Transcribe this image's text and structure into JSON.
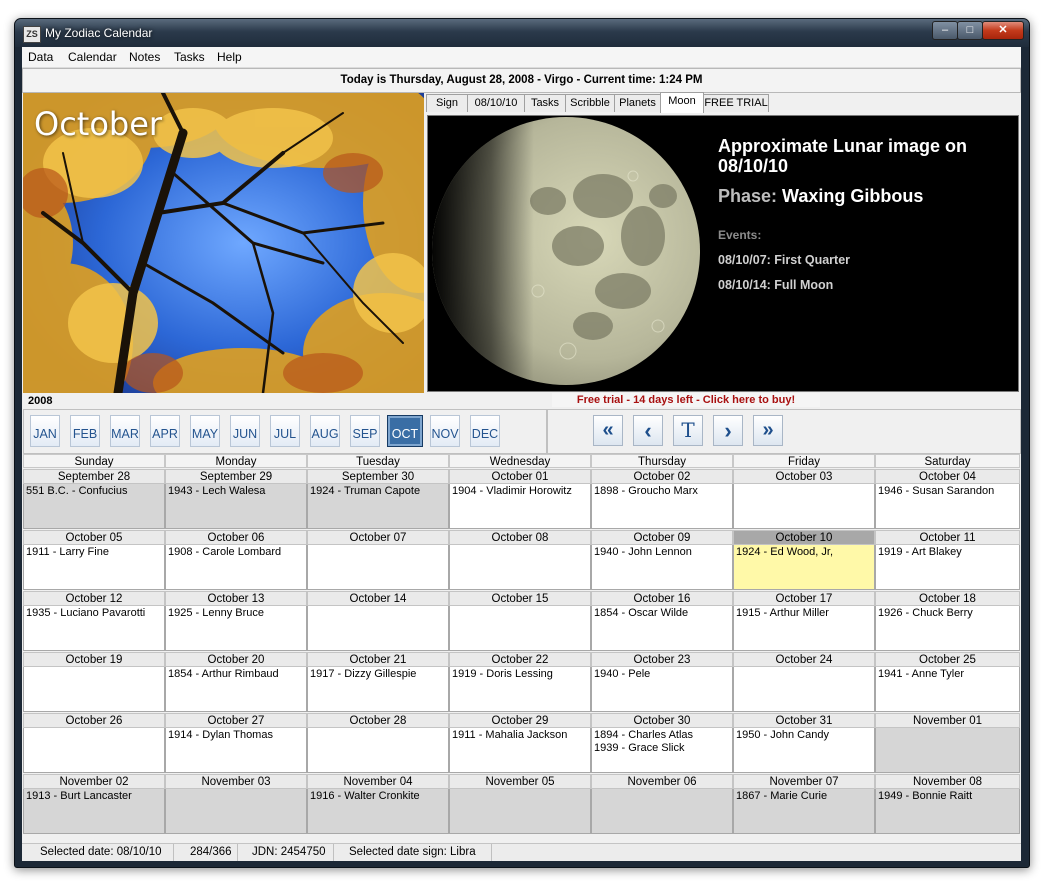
{
  "window": {
    "title": "My Zodiac Calendar",
    "icon": "ZS"
  },
  "menu": [
    "Data",
    "Calendar",
    "Notes",
    "Tasks",
    "Help"
  ],
  "today_banner": "Today is Thursday, August 28, 2008 - Virgo - Current time: 1:24 PM",
  "photo": {
    "month_label": "October"
  },
  "tabs": [
    {
      "label": "Sign",
      "active": false
    },
    {
      "label": "08/10/10",
      "active": false
    },
    {
      "label": "Tasks",
      "active": false
    },
    {
      "label": "Scribble",
      "active": false
    },
    {
      "label": "Planets",
      "active": false
    },
    {
      "label": "Moon",
      "active": true
    },
    {
      "label": "FREE TRIAL",
      "active": false
    }
  ],
  "moon": {
    "title": "Approximate Lunar image on 08/10/10",
    "phase_label": "Phase:",
    "phase_value": "Waxing Gibbous",
    "events_label": "Events:",
    "events": [
      "08/10/07: First Quarter",
      "08/10/14: Full Moon"
    ]
  },
  "year": "2008",
  "trial_text": "Free trial - 14 days left - Click here to buy!",
  "months": [
    "JAN",
    "FEB",
    "MAR",
    "APR",
    "MAY",
    "JUN",
    "JUL",
    "AUG",
    "SEP",
    "OCT",
    "NOV",
    "DEC"
  ],
  "active_month": "OCT",
  "nav": {
    "first_glyph": "«",
    "prev_glyph": "‹",
    "today_glyph": "T",
    "next_glyph": "›",
    "last_glyph": "»"
  },
  "weekdays": [
    "Sunday",
    "Monday",
    "Tuesday",
    "Wednesday",
    "Thursday",
    "Friday",
    "Saturday"
  ],
  "weeks": [
    [
      {
        "date": "September 28",
        "events": [
          "551 B.C. - Confucius"
        ],
        "other_month": true
      },
      {
        "date": "September 29",
        "events": [
          "1943 - Lech Walesa"
        ],
        "other_month": true
      },
      {
        "date": "September 30",
        "events": [
          "1924 - Truman Capote"
        ],
        "other_month": true
      },
      {
        "date": "October 01",
        "events": [
          "1904 - Vladimir Horowitz"
        ]
      },
      {
        "date": "October 02",
        "events": [
          "1898 - Groucho Marx"
        ]
      },
      {
        "date": "October 03",
        "events": []
      },
      {
        "date": "October 04",
        "events": [
          "1946 - Susan Sarandon"
        ]
      }
    ],
    [
      {
        "date": "October 05",
        "events": [
          "1911 - Larry Fine"
        ]
      },
      {
        "date": "October 06",
        "events": [
          "1908 - Carole Lombard"
        ]
      },
      {
        "date": "October 07",
        "events": []
      },
      {
        "date": "October 08",
        "events": []
      },
      {
        "date": "October 09",
        "events": [
          "1940 - John Lennon"
        ]
      },
      {
        "date": "October 10",
        "events": [
          "1924 - Ed Wood, Jr,"
        ],
        "selected": true
      },
      {
        "date": "October 11",
        "events": [
          "1919 - Art Blakey"
        ]
      }
    ],
    [
      {
        "date": "October 12",
        "events": [
          "1935 - Luciano Pavarotti"
        ]
      },
      {
        "date": "October 13",
        "events": [
          "1925 - Lenny Bruce"
        ]
      },
      {
        "date": "October 14",
        "events": []
      },
      {
        "date": "October 15",
        "events": []
      },
      {
        "date": "October 16",
        "events": [
          "1854 - Oscar Wilde"
        ]
      },
      {
        "date": "October 17",
        "events": [
          "1915 - Arthur Miller"
        ]
      },
      {
        "date": "October 18",
        "events": [
          "1926 - Chuck Berry"
        ]
      }
    ],
    [
      {
        "date": "October 19",
        "events": []
      },
      {
        "date": "October 20",
        "events": [
          "1854 - Arthur Rimbaud"
        ]
      },
      {
        "date": "October 21",
        "events": [
          "1917 - Dizzy Gillespie"
        ]
      },
      {
        "date": "October 22",
        "events": [
          "1919 - Doris Lessing"
        ]
      },
      {
        "date": "October 23",
        "events": [
          "1940 - Pele"
        ]
      },
      {
        "date": "October 24",
        "events": []
      },
      {
        "date": "October 25",
        "events": [
          "1941 - Anne Tyler"
        ]
      }
    ],
    [
      {
        "date": "October 26",
        "events": []
      },
      {
        "date": "October 27",
        "events": [
          "1914 - Dylan Thomas"
        ]
      },
      {
        "date": "October 28",
        "events": []
      },
      {
        "date": "October 29",
        "events": [
          "1911 - Mahalia Jackson"
        ]
      },
      {
        "date": "October 30",
        "events": [
          "1894 - Charles Atlas",
          "1939 - Grace Slick"
        ]
      },
      {
        "date": "October 31",
        "events": [
          "1950 - John Candy"
        ]
      },
      {
        "date": "November 01",
        "events": [],
        "other_month": true
      }
    ],
    [
      {
        "date": "November 02",
        "events": [
          "1913 - Burt Lancaster"
        ],
        "other_month": true
      },
      {
        "date": "November 03",
        "events": [],
        "other_month": true
      },
      {
        "date": "November 04",
        "events": [
          "1916 - Walter Cronkite"
        ],
        "other_month": true
      },
      {
        "date": "November 05",
        "events": [],
        "other_month": true
      },
      {
        "date": "November 06",
        "events": [],
        "other_month": true
      },
      {
        "date": "November 07",
        "events": [
          "1867 - Marie Curie"
        ],
        "other_month": true
      },
      {
        "date": "November 08",
        "events": [
          "1949 - Bonnie Raitt"
        ],
        "other_month": true
      }
    ]
  ],
  "status": {
    "selected_date": "Selected date: 08/10/10",
    "day_of_year": "284/366",
    "jdn": "JDN: 2454750",
    "sign": "Selected date sign: Libra"
  },
  "colors": {
    "accent": "#3a6ea5",
    "trial_red": "#a81010",
    "selected_day": "#fff9a8",
    "other_month": "#d6d6d6"
  }
}
